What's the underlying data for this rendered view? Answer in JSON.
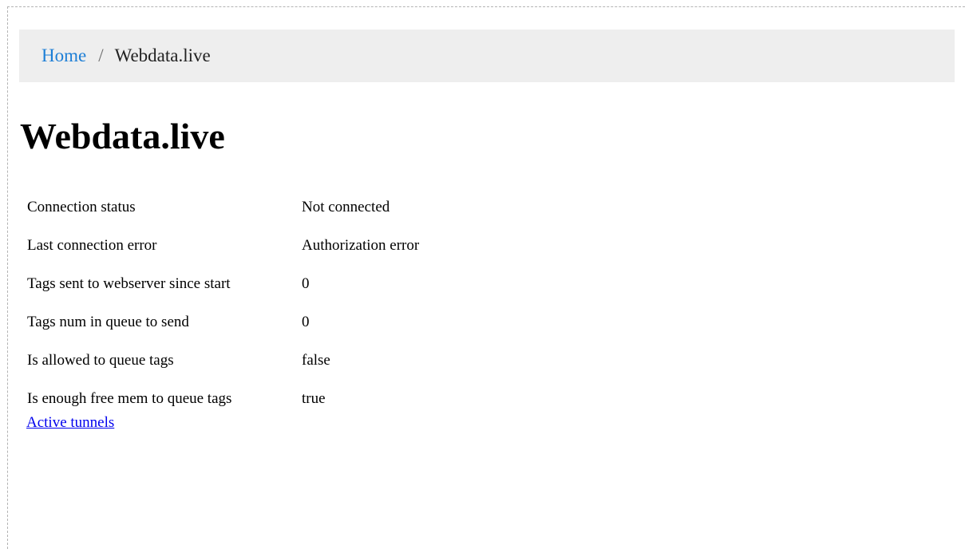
{
  "breadcrumb": {
    "home_label": "Home",
    "separator": "/",
    "current_label": "Webdata.live"
  },
  "page": {
    "title": "Webdata.live"
  },
  "status_rows": [
    {
      "label": "Connection status",
      "value": "Not connected"
    },
    {
      "label": "Last connection error",
      "value": "Authorization error"
    },
    {
      "label": "Tags sent to webserver since start",
      "value": "0"
    },
    {
      "label": "Tags num in queue to send",
      "value": "0"
    },
    {
      "label": "Is allowed to queue tags",
      "value": "false"
    },
    {
      "label": "Is enough free mem to queue tags",
      "value": "true"
    }
  ],
  "links": {
    "active_tunnels_label": "Active tunnels"
  },
  "colors": {
    "breadcrumb_background": "#eeeeee",
    "breadcrumb_link": "#1e7fd6",
    "hyperlink": "#0000ee",
    "frame_border": "#b3b3b3"
  }
}
